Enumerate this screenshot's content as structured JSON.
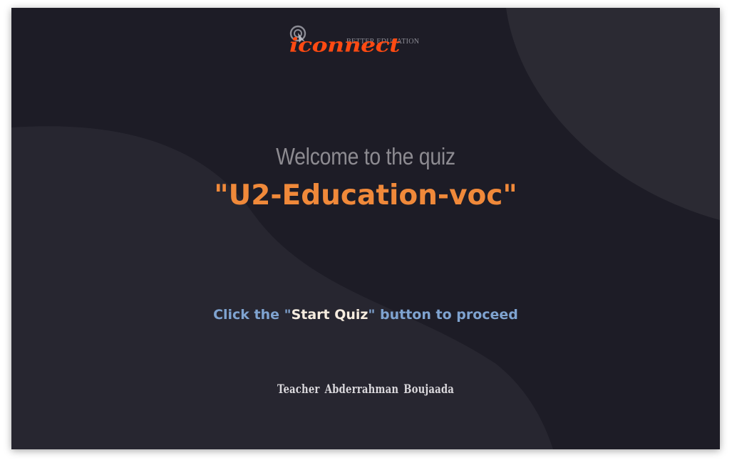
{
  "logo": {
    "brand": "iconnect",
    "tagline": "BETTER EDUCATION",
    "brand_color": "#ff4a12",
    "icon": "cursor-ring-icon"
  },
  "welcome": {
    "line": "Welcome to the quiz",
    "quiz_title": "\"U2-Education-voc\""
  },
  "instruction": {
    "prefix": "Click the \"",
    "button_name": "Start Quiz",
    "suffix": "\" button to proceed"
  },
  "footer": {
    "teacher": "Teacher Abderrahman Boujaada"
  },
  "colors": {
    "background": "#1d1c26",
    "title_accent": "#f0893a",
    "instruction": "#7fa3d0"
  }
}
